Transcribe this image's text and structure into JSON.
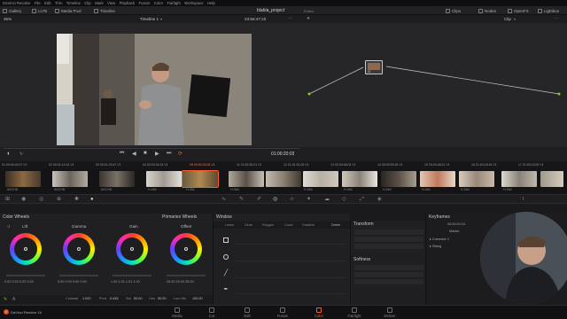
{
  "menubar": {
    "items": [
      "DaVinci Resolve",
      "File",
      "Edit",
      "Trim",
      "Timeline",
      "Clip",
      "Mark",
      "View",
      "Playback",
      "Fusion",
      "Color",
      "Fairlight",
      "Workspace",
      "Help"
    ]
  },
  "toolbar": {
    "left_buttons": [
      "Gallery",
      "LUTs",
      "Media Pool",
      "Timeline"
    ],
    "project_name": "blabla_project",
    "project_status": "Edited",
    "right_buttons": [
      "Clips",
      "Nodes",
      "OpenFX",
      "Lightbox"
    ]
  },
  "viewer": {
    "zoom": "35%",
    "timeline_name": "Timeline 1",
    "source_timecode": "23:56:47:20",
    "record_timecode": "01:00:20:03"
  },
  "node_editor": {
    "clip_menu": "Clip",
    "node_label": "01"
  },
  "clips": [
    {
      "num": "01",
      "timecode": "00:00:40:07",
      "track": "V1",
      "codec": "AVCHD"
    },
    {
      "num": "02",
      "timecode": "00:01:12:14",
      "track": "V1",
      "codec": "AVCHD"
    },
    {
      "num": "03",
      "timecode": "00:01:29:47",
      "track": "V1",
      "codec": "AVCHD"
    },
    {
      "num": "04",
      "timecode": "02:03:34:15",
      "track": "V1",
      "codec": "H.264"
    },
    {
      "num": "05",
      "timecode": "00:00:20:03",
      "track": "V1",
      "codec": "H.264"
    },
    {
      "num": "11",
      "timecode": "01:52:50:21",
      "track": "V1",
      "codec": "H.264"
    },
    {
      "num": "12",
      "timecode": "21:41:51:00",
      "track": "V1",
      "codec": "H.264"
    },
    {
      "num": "13",
      "timecode": "00:09:46:02",
      "track": "V1",
      "codec": "H.264"
    },
    {
      "num": "14",
      "timecode": "00:00:59:18",
      "track": "V1",
      "codec": "H.264"
    },
    {
      "num": "15",
      "timecode": "23:00:48:21",
      "track": "V1",
      "codec": "H.264"
    },
    {
      "num": "16",
      "timecode": "21:54:18:16",
      "track": "V1",
      "codec": "H.264"
    },
    {
      "num": "17",
      "timecode": "21:50:23:00",
      "track": "V1",
      "codec": "H.264"
    }
  ],
  "color_wheels": {
    "panel_title": "Color Wheels",
    "mode": "Primaries Wheels",
    "wheels": [
      {
        "name": "Lift",
        "values": "0.02  0.02  0.02  0.02"
      },
      {
        "name": "Gamma",
        "values": "0.00  0.00  0.00  0.00"
      },
      {
        "name": "Gain",
        "values": "1.00  1.01  1.01  1.00"
      },
      {
        "name": "Offset",
        "values": "25.00  25.00  25.00"
      }
    ],
    "contrast_label": "Contrast",
    "contrast_value": "1.000",
    "pivot_label": "Pivot",
    "pivot_value": "0.435",
    "sat_label": "Sat",
    "sat_value": "50.00",
    "hue_label": "Hue",
    "hue_value": "50.00",
    "lummix_label": "Lum Mix",
    "lummix_value": "100.00"
  },
  "window_panel": {
    "title": "Window",
    "shapes": [
      "Linear",
      "Circle",
      "Polygon",
      "Curve",
      "Gradient"
    ],
    "delete_label": "Delete"
  },
  "transform_panel": {
    "title": "Transform",
    "softness_title": "Softness"
  },
  "keyframes": {
    "title": "Keyframes",
    "timecode": "00:00:00:24",
    "track_master": "Master",
    "tracks": [
      "Corrector 1",
      "Sizing"
    ]
  },
  "pages": [
    "Media",
    "Cut",
    "Edit",
    "Fusion",
    "Color",
    "Fairlight",
    "Deliver"
  ],
  "active_page": "Color",
  "app_label": "DaVinci Resolve 16",
  "colors": {
    "accent": "#ff5a2a",
    "panel": "#202023"
  }
}
